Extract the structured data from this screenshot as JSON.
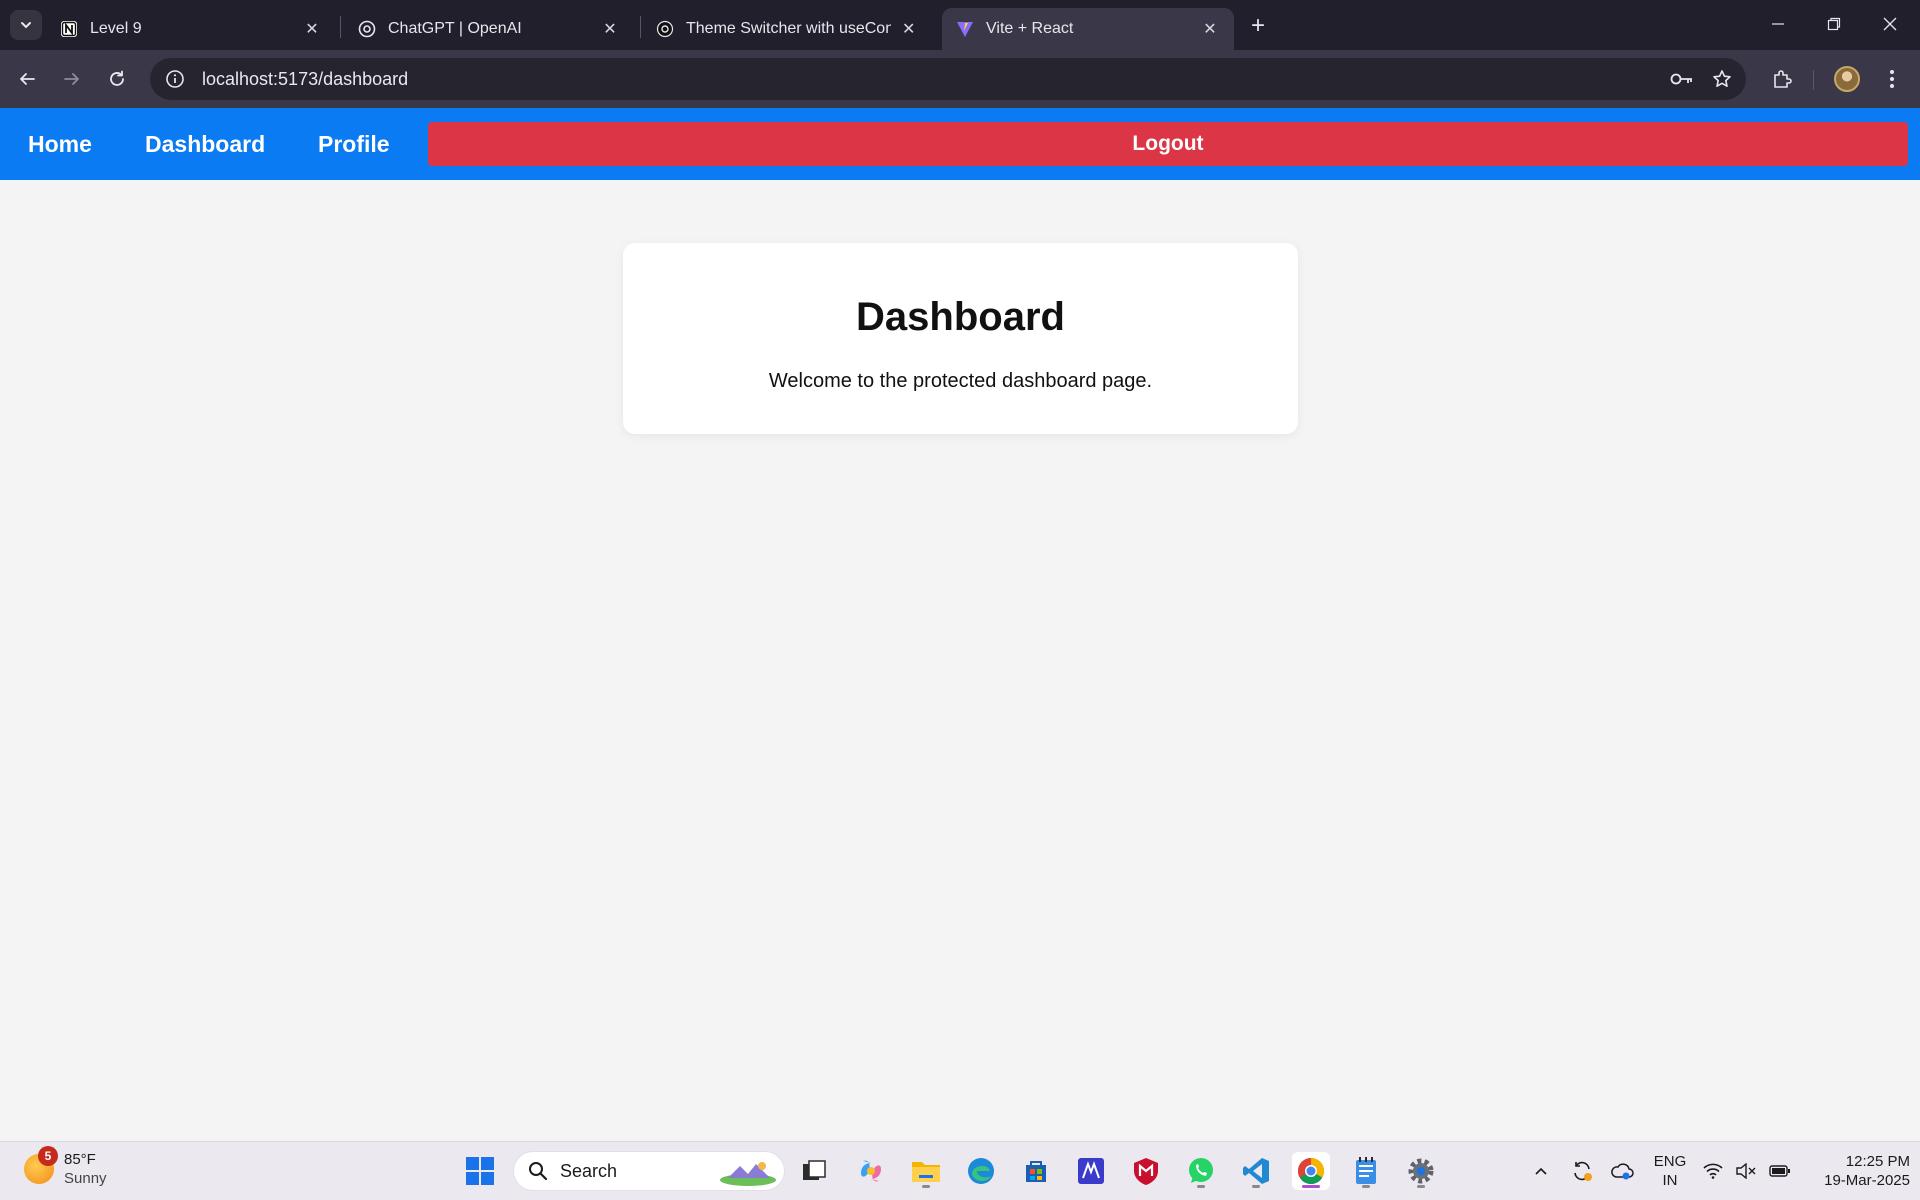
{
  "browser": {
    "tabs": [
      {
        "title": "Level 9",
        "icon": "notion-icon"
      },
      {
        "title": "ChatGPT | OpenAI",
        "icon": "openai-icon"
      },
      {
        "title": "Theme Switcher with useConte",
        "icon": "openai-icon"
      },
      {
        "title": "Vite + React",
        "icon": "vite-icon",
        "active": true
      }
    ],
    "url": "localhost:5173/dashboard"
  },
  "app": {
    "nav": {
      "home": "Home",
      "dashboard": "Dashboard",
      "profile": "Profile",
      "logout": "Logout"
    },
    "card": {
      "title": "Dashboard",
      "message": "Welcome to the protected dashboard page."
    },
    "colors": {
      "nav_bg": "#0a7bf2",
      "logout_bg": "#dc3545",
      "page_bg": "#f4f4f4"
    }
  },
  "taskbar": {
    "weather": {
      "badge": "5",
      "temp": "85°F",
      "condition": "Sunny"
    },
    "search_placeholder": "Search",
    "language": {
      "line1": "ENG",
      "line2": "IN"
    },
    "clock": {
      "time": "12:25 PM",
      "date": "19-Mar-2025"
    }
  }
}
